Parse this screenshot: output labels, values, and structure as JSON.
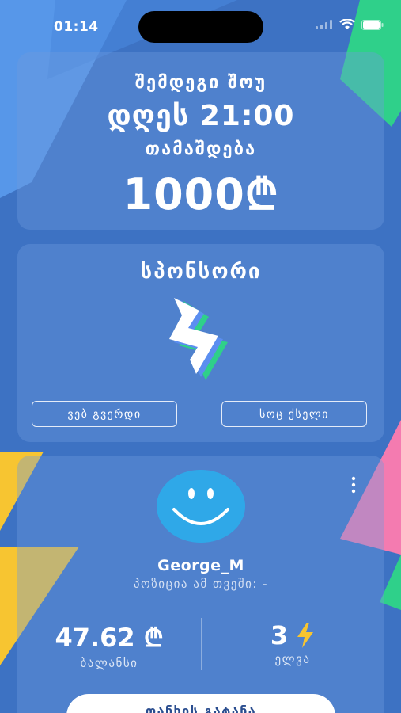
{
  "status_bar": {
    "time": "01:14",
    "signal_icon": "signal-icon",
    "wifi_icon": "wifi-icon",
    "battery_icon": "battery-icon"
  },
  "event": {
    "line1": "შემდეგი შოუ",
    "line2": "დღეს 21:00",
    "line3": "თამაშდება",
    "prize": "1000₾"
  },
  "sponsor": {
    "title": "სპონსორი",
    "logo_icon": "lightning-logo-icon",
    "web_button": "ვებ გვერდი",
    "social_button": "სოც ქსელი"
  },
  "profile": {
    "avatar_icon": "smiley-avatar-icon",
    "menu_icon": "more-vertical-icon",
    "username": "George_M",
    "position": "პოზიცია ამ თვეში: -",
    "balance_value": "47.62 ₾",
    "balance_label": "ბალანსი",
    "lightning_value": "3",
    "lightning_icon": "lightning-icon",
    "lightning_label": "ელვა"
  },
  "bottom_button": "თანხის გატანა",
  "colors": {
    "background": "#3d72c3",
    "accent_green": "#2fd08a",
    "accent_yellow": "#f7c531",
    "accent_pink": "#f47bb0"
  }
}
